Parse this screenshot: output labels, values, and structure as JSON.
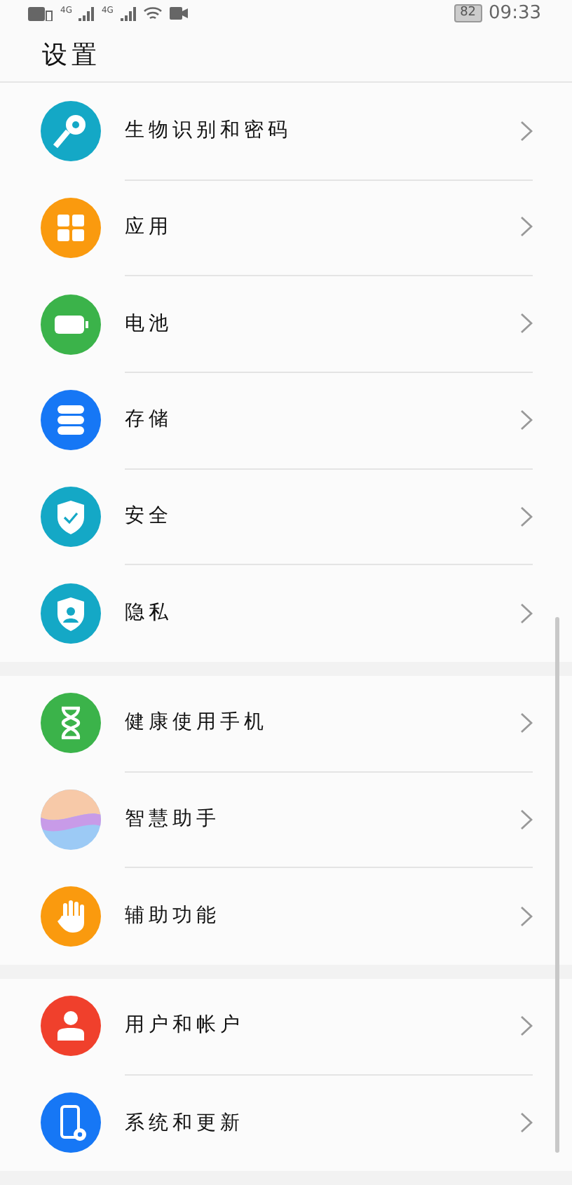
{
  "status_bar": {
    "network_labels": [
      "4G",
      "4G"
    ],
    "battery": "82",
    "time": "09:33"
  },
  "header": {
    "title": "设置"
  },
  "groups": [
    {
      "items": [
        {
          "label": "生物识别和密码",
          "kind": "key",
          "color": "#14a8c6"
        },
        {
          "label": "应用",
          "kind": "apps",
          "color": "#fa9a0e"
        },
        {
          "label": "电池",
          "kind": "battery",
          "color": "#3bb34a"
        },
        {
          "label": "存储",
          "kind": "storage",
          "color": "#1677f5"
        },
        {
          "label": "安全",
          "kind": "shield",
          "color": "#14a8c6"
        },
        {
          "label": "隐私",
          "kind": "privacy",
          "color": "#14a8c6"
        }
      ]
    },
    {
      "items": [
        {
          "label": "健康使用手机",
          "kind": "hourglass",
          "color": "#3bb34a"
        },
        {
          "label": "智慧助手",
          "kind": "assistant",
          "color": "#c89be8"
        },
        {
          "label": "辅助功能",
          "kind": "hand",
          "color": "#fa9a0e"
        }
      ]
    },
    {
      "items": [
        {
          "label": "用户和帐户",
          "kind": "user",
          "color": "#f0402c"
        },
        {
          "label": "系统和更新",
          "kind": "system",
          "color": "#1677f5"
        }
      ]
    }
  ]
}
